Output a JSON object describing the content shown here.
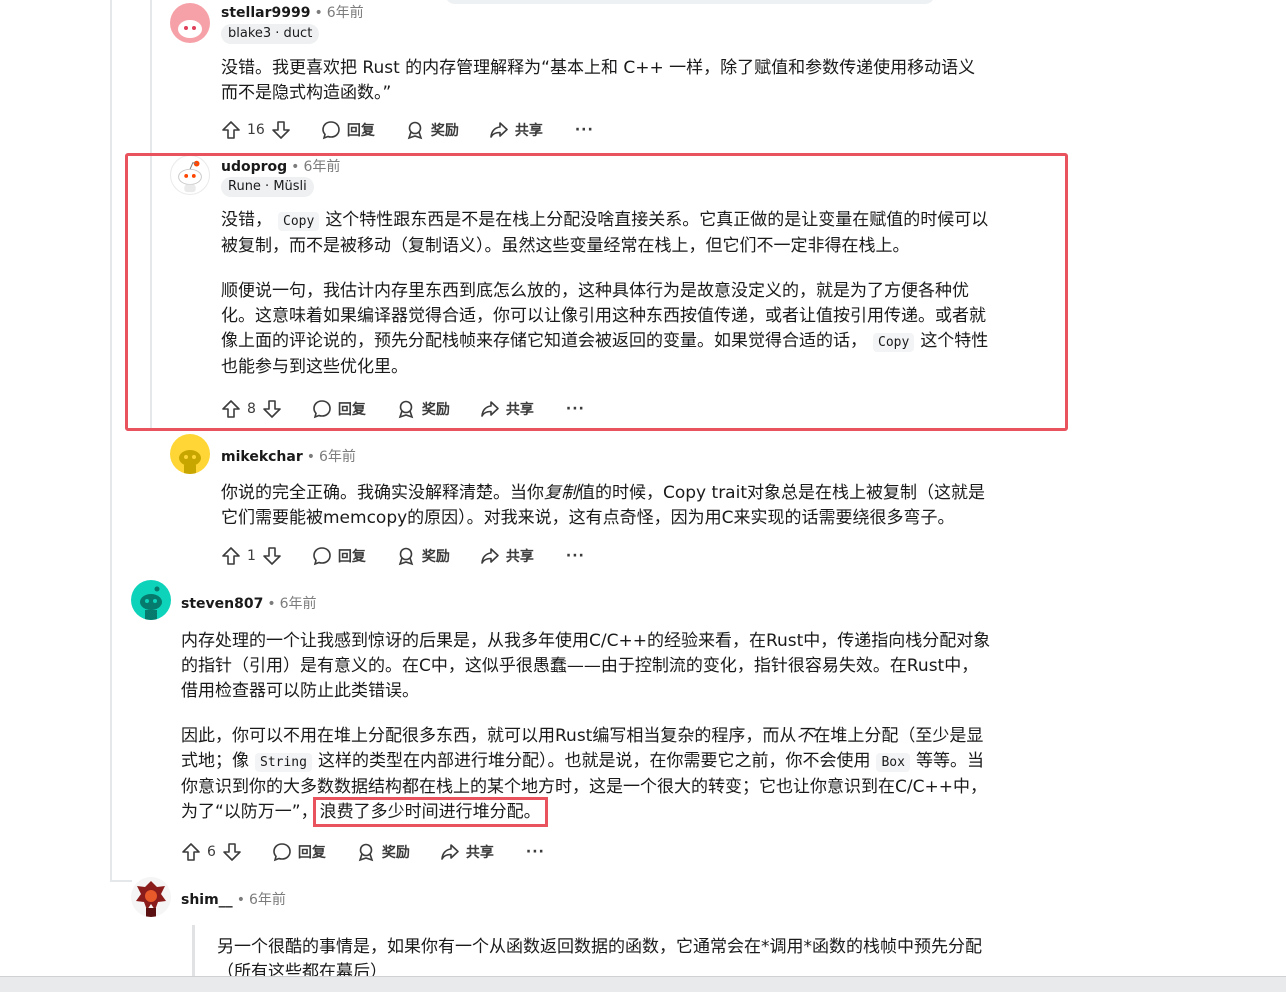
{
  "comments": [
    {
      "author": "stellar9999",
      "time": "6年前",
      "flair": "blake3 · duct",
      "paragraphs": [
        "没错。我更喜欢把 Rust 的内存管理解释为“基本上和 C++ 一样，除了赋值和参数传递使用移动语义而不是隐式构造函数。”"
      ],
      "votes": "16",
      "avatar_color": "#f6a1a8"
    },
    {
      "author": "udoprog",
      "time": "6年前",
      "flair": "Rune · Müsli",
      "p1_a": "没错，",
      "p1_code": "Copy",
      "p1_b": "这个特性跟东西是不是在栈上分配没啥直接关系。它真正做的是让变量在赋值的时候可以被复制，而不是被移动（复制语义）。虽然这些变量经常在栈上，但它们不一定非得在栈上。",
      "p2_a": "顺便说一句，我估计内存里东西到底怎么放的，这种具体行为是故意没定义的，就是为了方便各种优化。这意味着如果编译器觉得合适，你可以让像引用这种东西按值传递，或者让值按引用传递。或者就像上面的评论说的，预先分配栈帧来存储它知道会被返回的变量。如果觉得合适的话，",
      "p2_code": "Copy",
      "p2_b": "这个特性也能参与到这些优化里。",
      "votes": "8",
      "avatar_color": "#ffffff"
    },
    {
      "author": "mikekchar",
      "time": "6年前",
      "p1_a": "你说的完全正确。我确实没解释清楚。当你",
      "p1_em": "复制",
      "p1_b": "值的时候，Copy trait对象总是在栈上被复制（这就是它们需要能被memcopy的原因）。对我来说，这有点奇怪，因为用C来实现的话需要绕很多弯子。",
      "votes": "1",
      "avatar_color": "#ffd635"
    },
    {
      "author": "steven807",
      "time": "6年前",
      "p1": "内存处理的一个让我感到惊讶的后果是，从我多年使用C/C++的经验来看，在Rust中，传递指向栈分配对象的指针（引用）是有意义的。在C中，这似乎很愚蠢——由于控制流的变化，指针很容易失效。在Rust中，借用检查器可以防止此类错误。",
      "p2_a": "因此，你可以不用在堆上分配很多东西，就可以用Rust编写相当复杂的程序，而从",
      "p2_em": "不",
      "p2_b": "在堆上分配（至少是显式地；像",
      "p2_code1": "String",
      "p2_c": "这样的类型在内部进行堆分配）。也就是说，在你需要它之前，你不会使用",
      "p2_code2": "Box",
      "p2_d": "等等。当你意识到你的大多数数据结构都在栈上的某个地方时，这是一个很大的转变；它也让你意识到在C/C++中，为了“以防万一”，",
      "p2_highlight": "浪费了多少时间进行堆分配。",
      "votes": "6",
      "avatar_color": "#0dd3bb"
    },
    {
      "author": "shim__",
      "time": "6年前",
      "quote": "另一个很酷的事情是，如果你有一个从函数返回数据的函数，它通常会在*调用*函数的栈帧中预先分配（所有这些都在幕后）",
      "avatar_color": "#8a1c1c"
    }
  ],
  "actions": {
    "reply": "回复",
    "award": "奖励",
    "share": "共享",
    "more": "···"
  },
  "colors": {
    "highlight": "#e8535d",
    "thread_line": "#e5e8ea"
  }
}
